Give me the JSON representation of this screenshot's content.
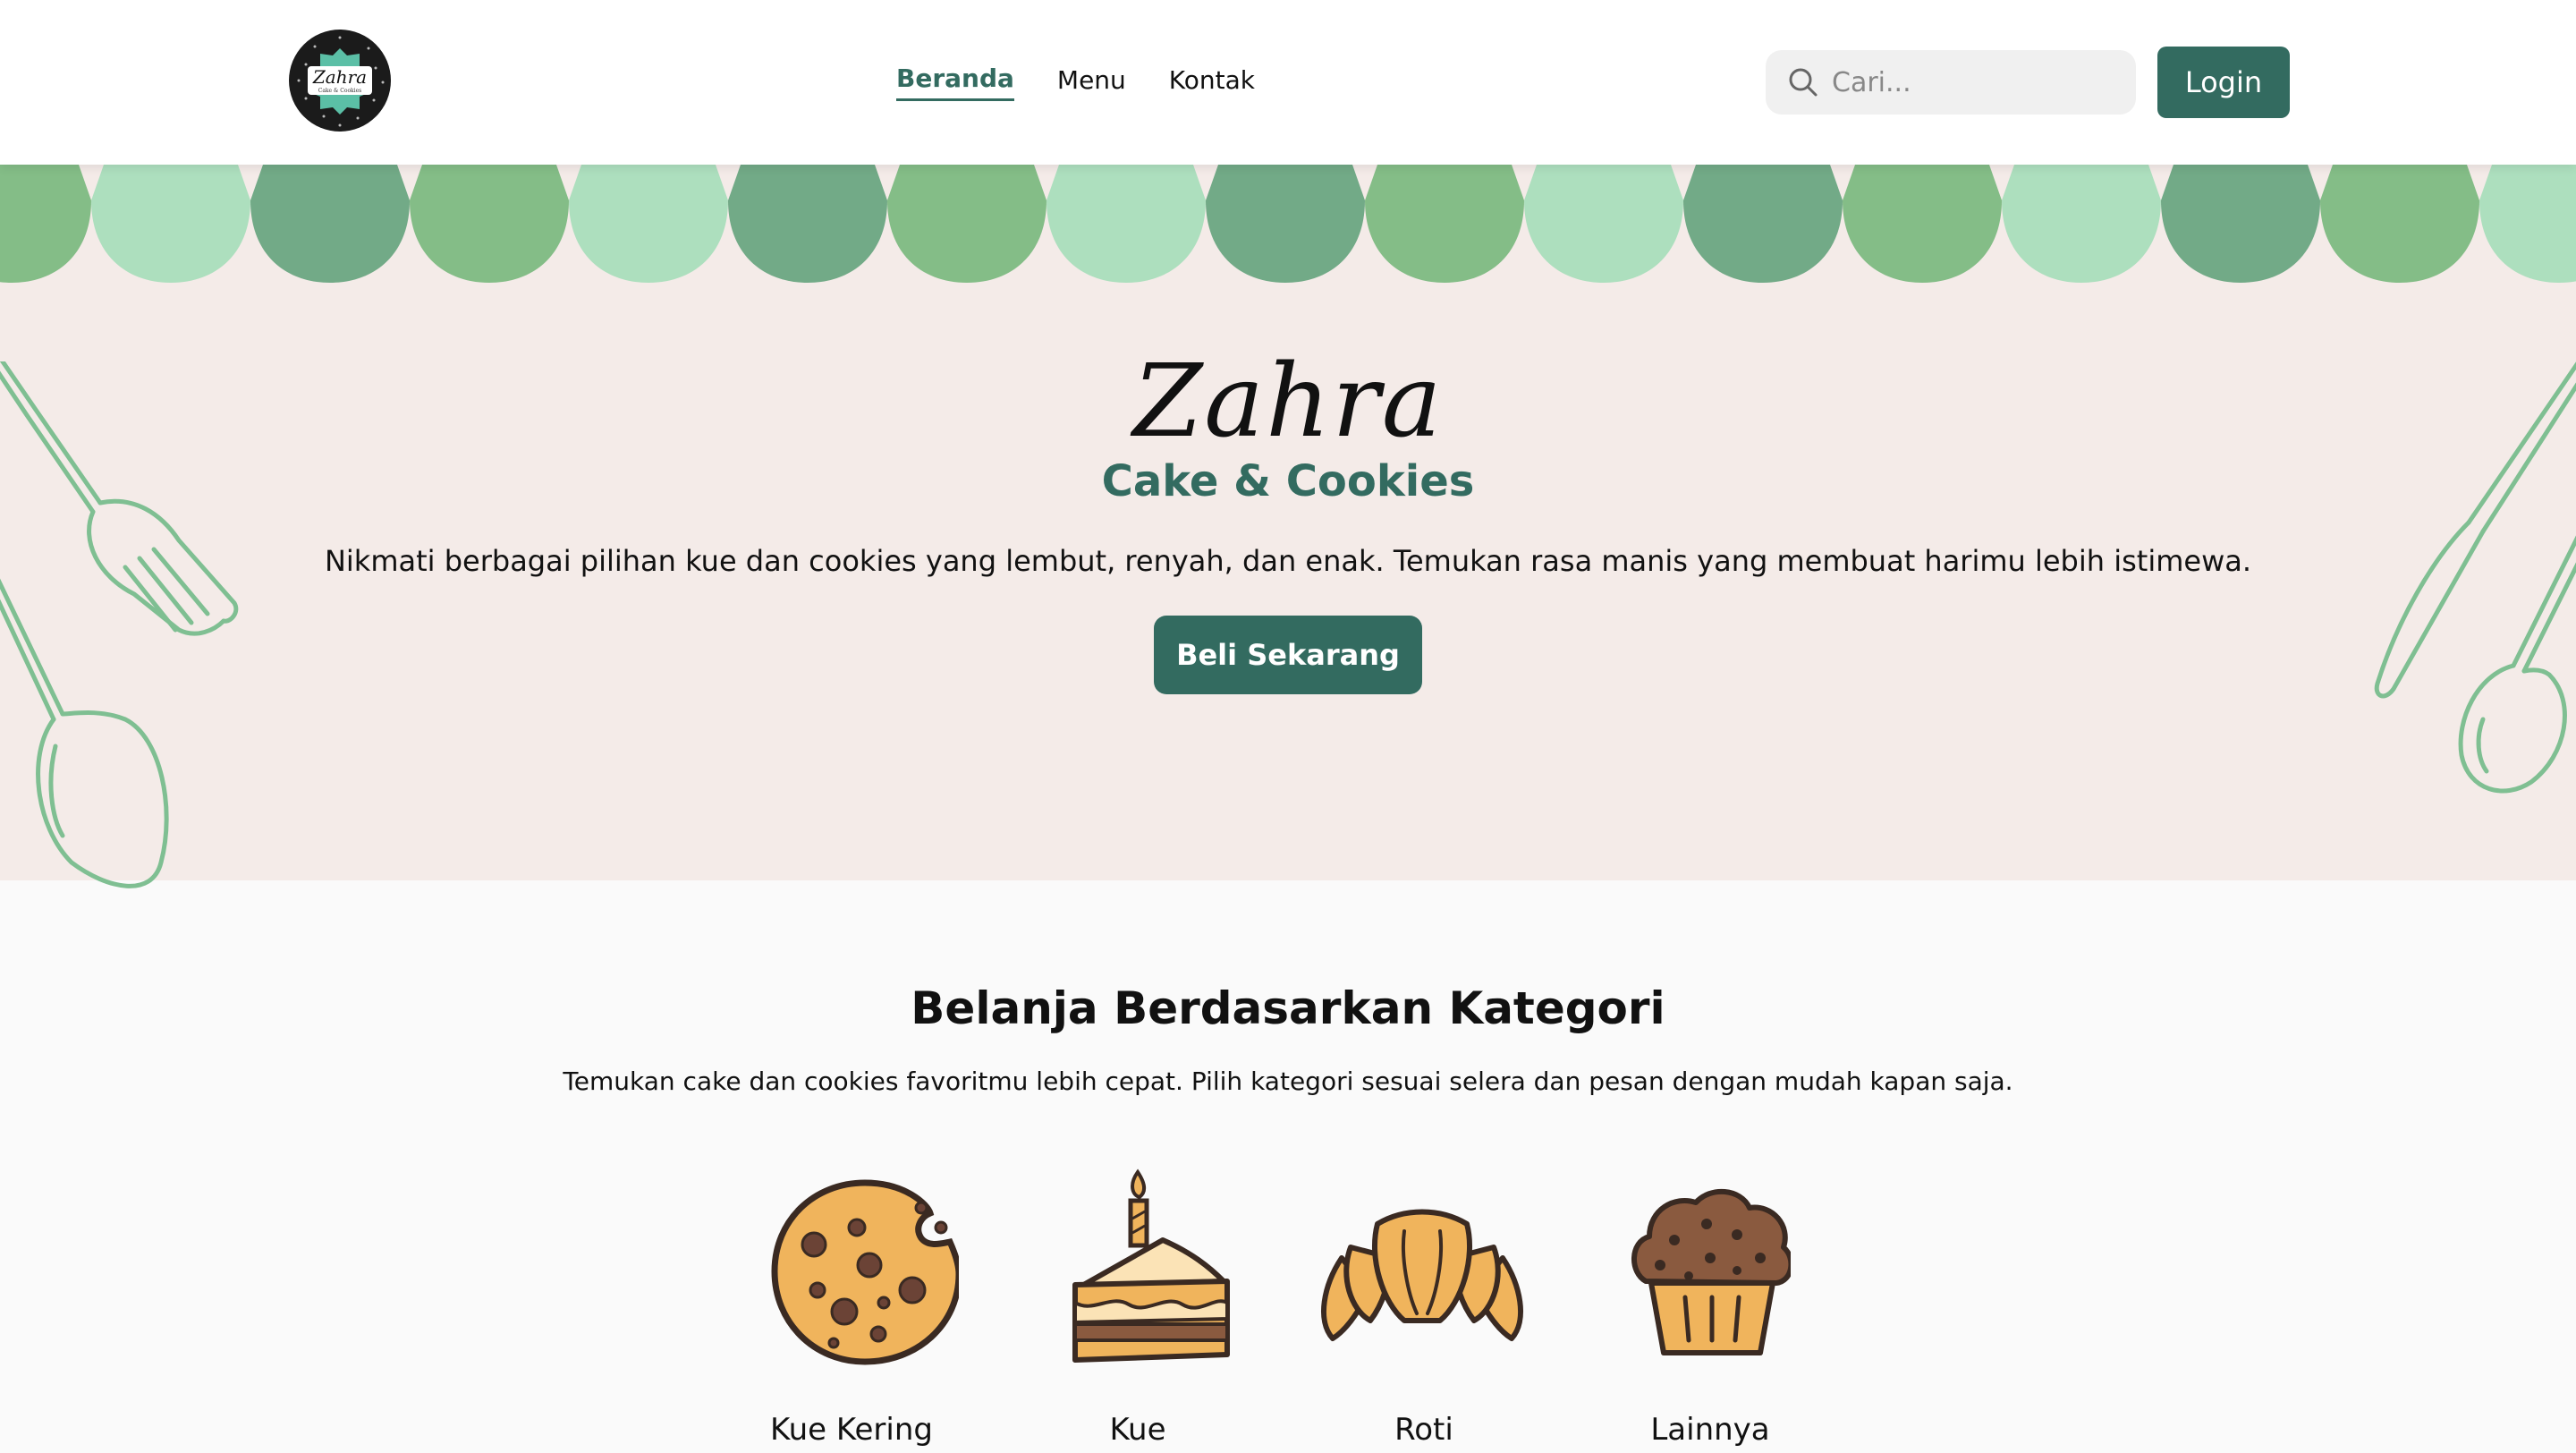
{
  "header": {
    "logo": {
      "script_text": "Zahra",
      "tagline": "Cake & Cookies"
    },
    "nav": [
      {
        "label": "Beranda",
        "active": true
      },
      {
        "label": "Menu",
        "active": false
      },
      {
        "label": "Kontak",
        "active": false
      }
    ],
    "search": {
      "placeholder": "Cari...",
      "icon": "search-icon"
    },
    "login_label": "Login"
  },
  "hero": {
    "brand": "Zahra",
    "subtitle": "Cake & Cookies",
    "description": "Nikmati berbagai pilihan kue dan cookies yang lembut, renyah, dan enak. Temukan rasa manis yang membuat harimu lebih istimewa.",
    "cta_label": "Beli Sekarang"
  },
  "categories": {
    "title": "Belanja Berdasarkan Kategori",
    "description": "Temukan cake dan cookies favoritmu lebih cepat. Pilih kategori sesuai selera dan pesan dengan mudah kapan saja.",
    "items": [
      {
        "label": "Kue Kering",
        "icon": "cookie-icon"
      },
      {
        "label": "Kue",
        "icon": "cake-slice-icon"
      },
      {
        "label": "Roti",
        "icon": "croissant-icon"
      },
      {
        "label": "Lainnya",
        "icon": "muffin-icon"
      }
    ]
  },
  "colors": {
    "primary": "#336b60",
    "hero_bg": "#f4ebe8",
    "awning_light": "#addfbe",
    "awning_mid": "#84bd87",
    "awning_dark": "#72aa87",
    "utensil_stroke": "#7fbf92"
  }
}
